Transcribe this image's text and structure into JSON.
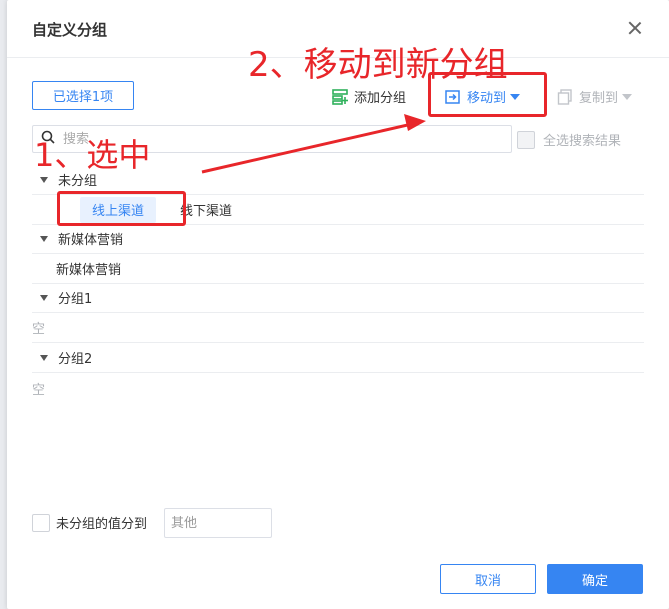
{
  "dialog": {
    "title": "自定义分组"
  },
  "toolbar": {
    "selected_label": "已选择1项",
    "add_group_label": "添加分组",
    "move_to_label": "移动到",
    "copy_to_label": "复制到"
  },
  "search": {
    "placeholder": "搜索",
    "select_all_label": "全选搜索结果"
  },
  "groups": [
    {
      "name": "未分组",
      "items": [
        "线上渠道",
        "线下渠道"
      ],
      "selected": "线上渠道"
    },
    {
      "name": "新媒体营销",
      "items": [
        "新媒体营销"
      ]
    },
    {
      "name": "分组1",
      "empty_label": "空"
    },
    {
      "name": "分组2",
      "empty_label": "空"
    }
  ],
  "footer": {
    "unassigned_label": "未分组的值分到",
    "other_placeholder": "其他",
    "cancel_label": "取消",
    "ok_label": "确定"
  },
  "annotations": {
    "step1": "1、选中",
    "step2": "2、移动到新分组",
    "color": "#e8262a"
  },
  "colors": {
    "accent": "#3685f2",
    "selected_bg": "#e8f1fe"
  }
}
